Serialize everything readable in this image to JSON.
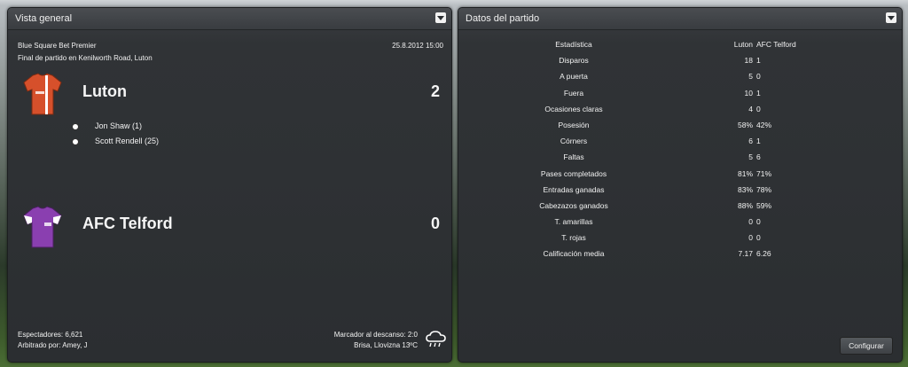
{
  "overview": {
    "title": "Vista general",
    "competition": "Blue Square Bet Premier",
    "date_time": "25.8.2012 15:00",
    "venue": "Final de partido en Kenilworth Road, Luton",
    "home": {
      "name": "Luton",
      "score": "2",
      "shirt_color": "#d6502b",
      "goals": [
        "Jon Shaw (1)",
        "Scott Rendell (25)"
      ]
    },
    "away": {
      "name": "AFC Telford",
      "score": "0",
      "shirt_color": "#8a3fb0"
    },
    "attendance": "Espectadores: 6,621",
    "referee": "Arbitrado por: Amey, J",
    "half_time": "Marcador al descanso: 2:0",
    "weather": "Brisa, Llovizna 13ºC",
    "weather_icon": "cloud-rain-icon"
  },
  "stats": {
    "title": "Datos del partido",
    "header": {
      "label": "Estadística",
      "home": "Luton",
      "away": "AFC Telford"
    },
    "rows": [
      {
        "label": "Disparos",
        "home": "18",
        "away": "1"
      },
      {
        "label": "A puerta",
        "home": "5",
        "away": "0"
      },
      {
        "label": "Fuera",
        "home": "10",
        "away": "1"
      },
      {
        "label": "Ocasiones claras",
        "home": "4",
        "away": "0"
      },
      {
        "label": "Posesión",
        "home": "58%",
        "away": "42%"
      },
      {
        "label": "Córners",
        "home": "6",
        "away": "1"
      },
      {
        "label": "Faltas",
        "home": "5",
        "away": "6"
      },
      {
        "label": "Pases completados",
        "home": "81%",
        "away": "71%"
      },
      {
        "label": "Entradas ganadas",
        "home": "83%",
        "away": "78%"
      },
      {
        "label": "Cabezazos ganados",
        "home": "88%",
        "away": "59%"
      },
      {
        "label": "T. amarillas",
        "home": "0",
        "away": "0"
      },
      {
        "label": "T. rojas",
        "home": "0",
        "away": "0"
      },
      {
        "label": "Calificación media",
        "home": "7.17",
        "away": "6.26"
      }
    ],
    "configure_label": "Configurar"
  }
}
